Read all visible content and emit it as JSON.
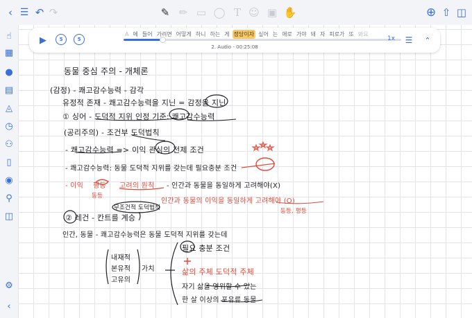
{
  "toolbar": {
    "left_icons": [
      "sidebar-toggle-icon",
      "grid-view-icon",
      "undo-icon",
      "redo-icon"
    ],
    "tools": [
      "pen-icon",
      "pencil-icon",
      "eraser-icon",
      "lasso-icon",
      "text-icon",
      "sticker-icon",
      "image-icon",
      "hand-icon"
    ],
    "right_icons": [
      "add-page-icon",
      "share-icon",
      "page-layout-icon"
    ]
  },
  "sidebar": {
    "icons": [
      "touch-icon",
      "ruler-icon",
      "microphone-icon",
      "document-icon",
      "bookmark-icon",
      "timer-icon",
      "people-icon",
      "page-icon",
      "robot-icon",
      "search-icon",
      "presentation-icon",
      "settings-icon",
      "collapse-icon"
    ]
  },
  "audio": {
    "words": [
      {
        "text": "A",
        "state": "first"
      },
      {
        "text": "에",
        "state": "normal"
      },
      {
        "text": "들어",
        "state": "normal"
      },
      {
        "text": "가려면",
        "state": "normal"
      },
      {
        "text": "어떻게",
        "state": "normal"
      },
      {
        "text": "하니",
        "state": "normal"
      },
      {
        "text": "하는",
        "state": "normal"
      },
      {
        "text": "게",
        "state": "normal"
      },
      {
        "text": "정당이자",
        "state": "current"
      },
      {
        "text": "싶어",
        "state": "normal"
      },
      {
        "text": "는",
        "state": "normal"
      },
      {
        "text": "애로",
        "state": "normal"
      },
      {
        "text": "가야",
        "state": "normal"
      },
      {
        "text": "돼",
        "state": "normal"
      },
      {
        "text": "자",
        "state": "normal"
      },
      {
        "text": "피로가",
        "state": "normal"
      },
      {
        "text": "또",
        "state": "normal"
      },
      {
        "text": "봐요",
        "state": "fade"
      }
    ],
    "title": "2. Audio - 00:25:08",
    "speed": "1x",
    "progress": 0.14,
    "skip_back": "5",
    "skip_forward": "5"
  },
  "notes": {
    "l1": "동물 중심 주의 - 개체론",
    "l2": "(감정) - 쾌고감수능력 - 감각",
    "l3": "유정적 존재 - 쾌고감수능력을 지닌 = 감정을 지닌",
    "l4": "① 싱어 - 도덕적 지위 인정 기준: 쾌고감수능력",
    "l5": "(공리주의) - 조건부 도덕법칙",
    "l6": "- 쾌고감수능력 => 이익 관심의 전제 조건",
    "l7": "- 쾌고감수능력: 동물 도덕적 지위를 갖는데 필요충분 조건",
    "l8a": "- 이익",
    "l8b": "평등",
    "l8c": "고려의 원칙",
    "l8d": "- 인간과 동물을 동일하게 고려해야(X)",
    "l9a": "동등",
    "l9b": "인간과 동물의 이익을 동일하게 고려해야 (O)",
    "l9c": "동등, 평등",
    "l10a": "무조건적 도덕법칙",
    "l10b": "② 레건 - 칸트를 계승",
    "l11": "인간, 동물 - 쾌고감수능력은 동물 도덕적 지위를 갖는데",
    "l12": "필요 충분 조건",
    "l13a": "내재적",
    "l13b": "본유적",
    "l13c": "고유의",
    "l13d": "가치",
    "l14": "삶의 주체 도덕적 주체",
    "l15": "자기 삶을 영위할 수 있는",
    "l16": "한 살 이상의 포유류 동물"
  }
}
